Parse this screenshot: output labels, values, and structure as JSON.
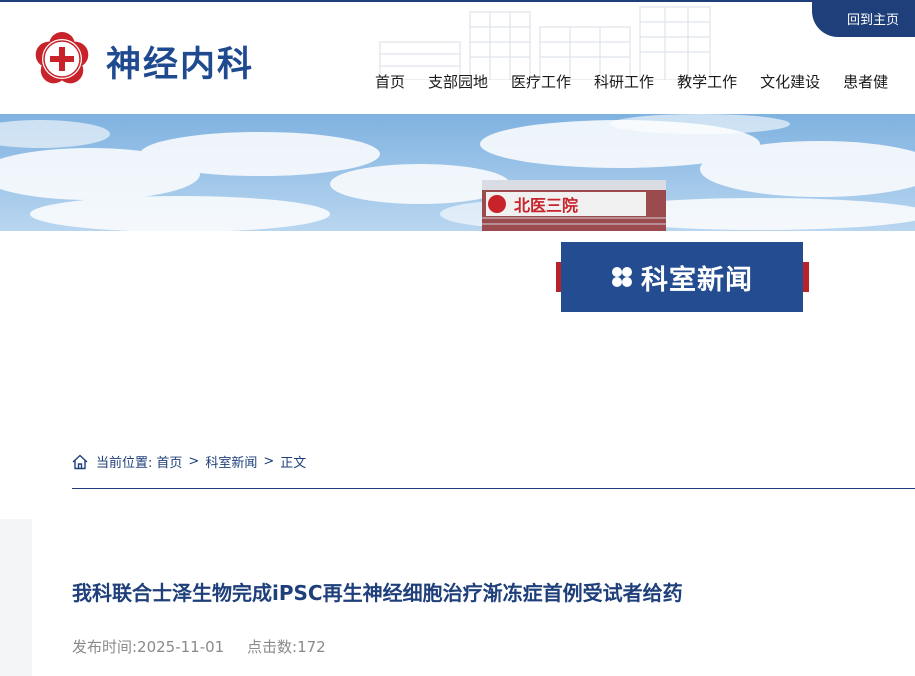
{
  "header": {
    "site_title": "神经内科",
    "home_link": "回到主页",
    "logo_icon": "hospital-emblem-icon",
    "nav": [
      "首页",
      "支部园地",
      "医疗工作",
      "科研工作",
      "教学工作",
      "文化建设",
      "患者健"
    ]
  },
  "banner": {
    "building_sign": "北医三院"
  },
  "section": {
    "title": "科室新闻",
    "icon": "clover-icon"
  },
  "breadcrumb": {
    "prefix": "当前位置:",
    "items": [
      "首页",
      "科室新闻",
      "正文"
    ],
    "separator": ">"
  },
  "article": {
    "title": "我科联合士泽生物完成iPSC再生神经细胞治疗渐冻症首例受试者给药",
    "publish": "发布时间:2025-11-01",
    "clicks": "点击数:172"
  },
  "colors": {
    "primary": "#1e3f7a",
    "accent_red": "#b8232a",
    "section_blue": "#234c91"
  }
}
